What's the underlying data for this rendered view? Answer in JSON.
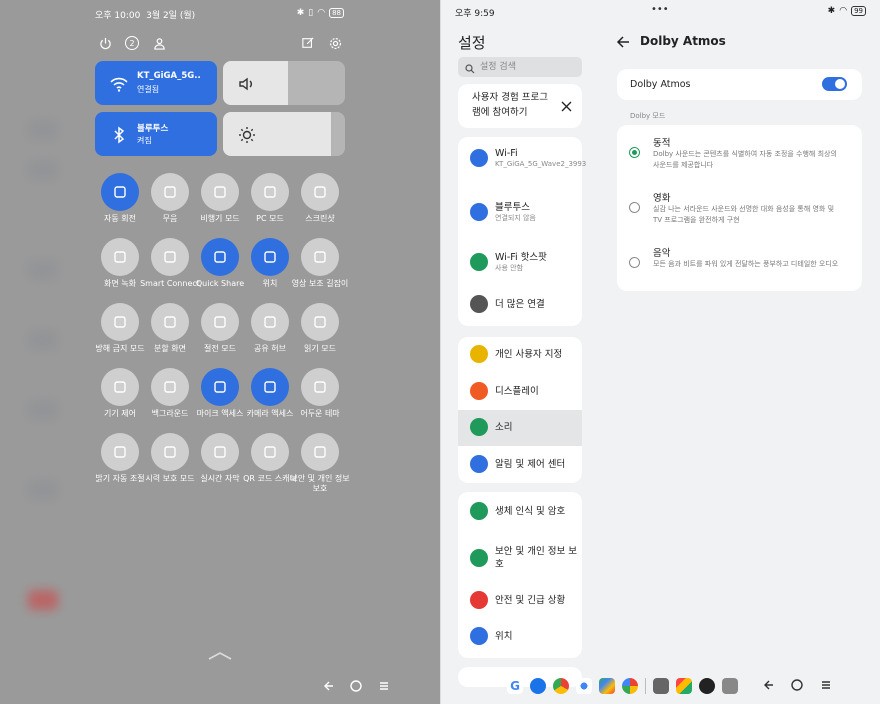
{
  "left": {
    "status": {
      "time": "오후 10:00",
      "date": "3월 2일 (월)",
      "battery": "88"
    },
    "top_row": {
      "badge": "2"
    },
    "tiles": {
      "wifi": {
        "name": "KT_GiGA_5G..",
        "status": "연결됨"
      },
      "bluetooth": {
        "name": "블루투스",
        "status": "켜짐"
      }
    },
    "grid": [
      {
        "label": "자동 회전",
        "icon": "rotate-icon",
        "on": true
      },
      {
        "label": "무음",
        "icon": "bell-icon",
        "on": false
      },
      {
        "label": "비행기 모드",
        "icon": "airplane-icon",
        "on": false
      },
      {
        "label": "PC 모드",
        "icon": "monitor-icon",
        "on": false
      },
      {
        "label": "스크린샷",
        "icon": "screenshot-icon",
        "on": false
      },
      {
        "label": "화면 녹화",
        "icon": "record-icon",
        "on": false
      },
      {
        "label": "Smart Connect",
        "icon": "smart-connect-icon",
        "on": false
      },
      {
        "label": "Quick Share",
        "icon": "quick-share-icon",
        "on": true
      },
      {
        "label": "위치",
        "icon": "location-icon",
        "on": true
      },
      {
        "label": "영상 보조 길잡이",
        "icon": "video-icon",
        "on": false
      },
      {
        "label": "방해 금지 모드",
        "icon": "moon-icon",
        "on": false
      },
      {
        "label": "분할 화면",
        "icon": "split-screen-icon",
        "on": false
      },
      {
        "label": "절전 모드",
        "icon": "battery-icon",
        "on": false
      },
      {
        "label": "공유 허브",
        "icon": "share-hub-icon",
        "on": false
      },
      {
        "label": "읽기 모드",
        "icon": "book-icon",
        "on": false
      },
      {
        "label": "기기 제어",
        "icon": "home-icon",
        "on": false
      },
      {
        "label": "백그라운드",
        "icon": "hearing-icon",
        "on": false
      },
      {
        "label": "마이크 액세스",
        "icon": "mic-icon",
        "on": true
      },
      {
        "label": "카메라 액세스",
        "icon": "camera-icon",
        "on": true
      },
      {
        "label": "어두운 테마",
        "icon": "dark-theme-icon",
        "on": false
      },
      {
        "label": "밝기 자동 조절",
        "icon": "auto-brightness-icon",
        "on": false
      },
      {
        "label": "시력 보호 모드",
        "icon": "eye-icon",
        "on": false
      },
      {
        "label": "실시간 자막",
        "icon": "caption-icon",
        "on": false
      },
      {
        "label": "QR 코드 스캐너",
        "icon": "qr-icon",
        "on": false
      },
      {
        "label": "보안 및 개인 정보 보호",
        "icon": "shield-icon",
        "on": false
      }
    ]
  },
  "right": {
    "status": {
      "time": "오후 9:59",
      "battery": "99"
    },
    "settings_title": "설정",
    "search_placeholder": "설정 검색",
    "promo": "사용자 경험 프로그램에 참여하기",
    "groups": [
      [
        {
          "label": "Wi-Fi",
          "sub": "KT_GiGA_5G_Wave2_3993",
          "color": "#2f6fe0"
        },
        {
          "label": "블루투스",
          "sub": "연결되지 않음",
          "color": "#2f6fe0"
        },
        {
          "label": "Wi-Fi 핫스팟",
          "sub": "사용 안함",
          "color": "#1f9a5a"
        },
        {
          "label": "더 많은 연결",
          "sub": "",
          "color": "#555555"
        }
      ],
      [
        {
          "label": "개인 사용자 지정",
          "sub": "",
          "color": "#e8b400"
        },
        {
          "label": "디스플레이",
          "sub": "",
          "color": "#f05a23"
        },
        {
          "label": "소리",
          "sub": "",
          "color": "#1f9a5a"
        },
        {
          "label": "알림 및 제어 센터",
          "sub": "",
          "color": "#2f6fe0"
        }
      ],
      [
        {
          "label": "생체 인식 및 암호",
          "sub": "",
          "color": "#1f9a5a"
        },
        {
          "label": "보안 및 개인 정보 보호",
          "sub": "",
          "color": "#1f9a5a"
        },
        {
          "label": "안전 및 긴급 상황",
          "sub": "",
          "color": "#e53935"
        },
        {
          "label": "위치",
          "sub": "",
          "color": "#2f6fe0"
        }
      ]
    ],
    "detail": {
      "title": "Dolby Atmos",
      "toggle_label": "Dolby Atmos",
      "toggle_on": true,
      "mode_header": "Dolby 모드",
      "options": [
        {
          "title": "동적",
          "desc": "Dolby 사운드는 콘텐츠를 식별하여 자동 조정을 수행해 최상의 사운드를 제공합니다",
          "selected": true
        },
        {
          "title": "영화",
          "desc": "실감 나는 서라운드 사운드와 선명한 대화 음성을 통해 영화 및 TV 프로그램을 완전하게 구현",
          "selected": false
        },
        {
          "title": "음악",
          "desc": "모든 음과 비트를 파워 있게 전달하는 풍부하고 디테일한 오디오",
          "selected": false
        }
      ]
    }
  }
}
